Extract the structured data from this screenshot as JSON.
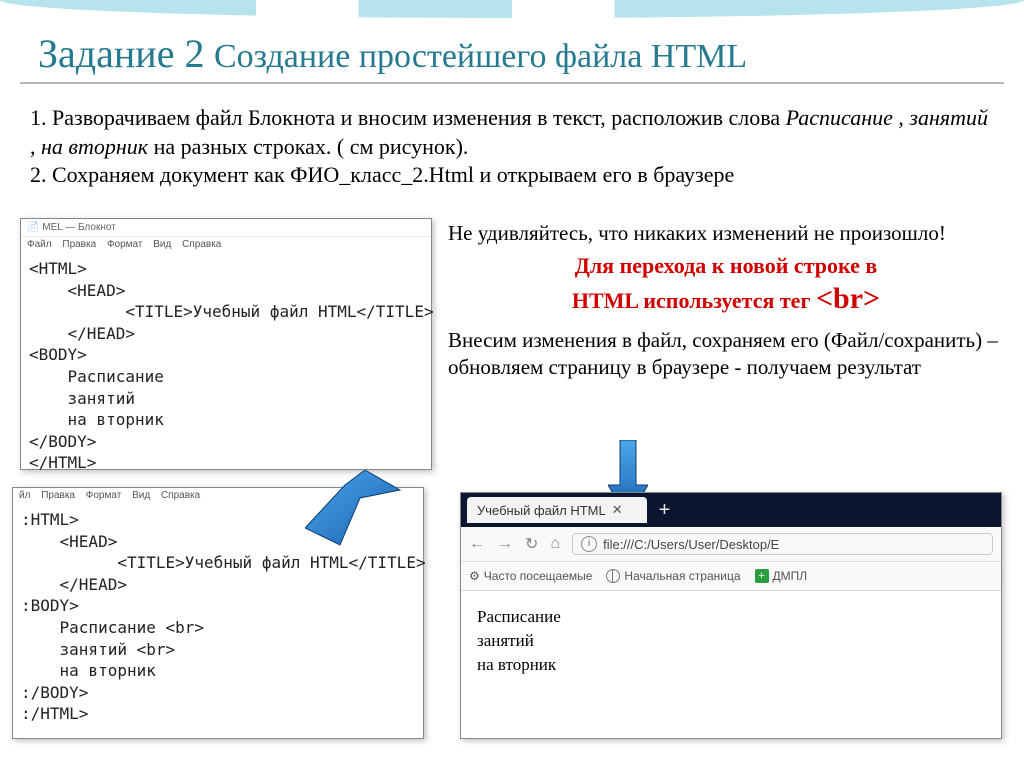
{
  "title": {
    "part1": "Задание 2",
    "part2": "Создание простейшего файла HTML"
  },
  "instructions": {
    "line1_a": "1. Разворачиваем файл Блокнота и вносим изменения в текст, расположив слова ",
    "line1_b": "Расписание",
    "line1_c": ", ",
    "line1_d": "занятий",
    "line1_e": ", ",
    "line1_f": "на вторник",
    "line1_g": " на разных строках. ( см рисунок).",
    "line2": "2. Сохраняем документ как ФИО_класс_2.Html и открываем его в браузере"
  },
  "notepad1": {
    "title": "MEL — Блокнот",
    "menu": [
      "Файл",
      "Правка",
      "Формат",
      "Вид",
      "Справка"
    ],
    "code": "<HTML>\n    <HEAD>\n          <TITLE>Учебный файл HTML</TITLE>\n    </HEAD>\n<BODY>\n    Расписание\n    занятий\n    на вторник\n</BODY>\n</HTML>"
  },
  "right": {
    "p1": "Не удивляйтесь, что никаких изменений не произошло!",
    "red1": "Для перехода к новой строке в",
    "red2a": "HTML используется тег ",
    "red2b": "<br>",
    "p2": "Внесим изменения в файл, сохраняем его (Файл/сохранить) – обновляем страницу в браузере - получаем результат"
  },
  "notepad2": {
    "menu": [
      "йл",
      "Правка",
      "Формат",
      "Вид",
      "Справка"
    ],
    "code": ":HTML>\n    <HEAD>\n          <TITLE>Учебный файл HTML</TITLE>\n    </HEAD>\n:BODY>\n    Расписание <br>\n    занятий <br>\n    на вторник\n:/BODY>\n:/HTML>"
  },
  "browser": {
    "tab_title": "Учебный файл HTML",
    "url": "file:///C:/Users/User/Desktop/E",
    "bookmarks": {
      "b1": "Часто посещаемые",
      "b2": "Начальная страница",
      "b3": "ДМПЛ"
    },
    "content_l1": "Расписание",
    "content_l2": "занятий",
    "content_l3": "на вторник"
  }
}
